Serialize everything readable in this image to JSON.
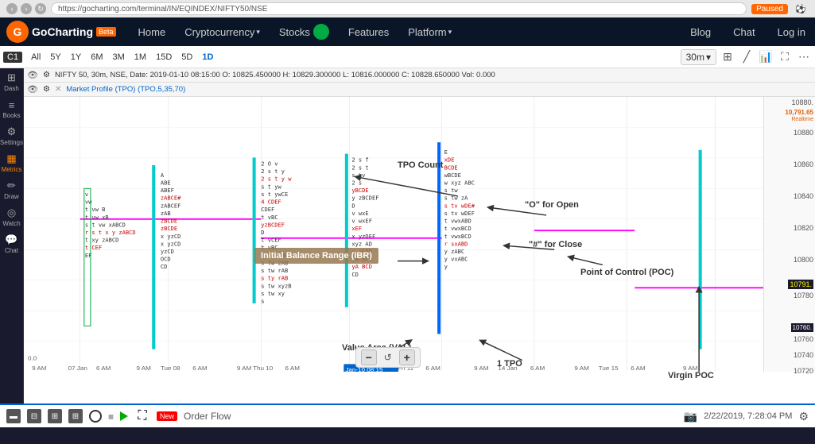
{
  "browser": {
    "url": "https://gocharting.com/terminal/IN/EQINDEX/NIFTY50/NSE",
    "paused_label": "Paused"
  },
  "nav": {
    "logo": "GoCharting",
    "beta_label": "Beta",
    "items": [
      "Home",
      "Cryptocurrency",
      "Stocks",
      "Features",
      "Platform"
    ],
    "right_items": [
      "Blog",
      "Chat",
      "Log in"
    ],
    "crypto_label": "Cryptocurrency",
    "stocks_label": "Stocks",
    "features_label": "Features",
    "platform_label": "Platform",
    "blog_label": "Blog",
    "chat_label": "Chat",
    "login_label": "Log in",
    "home_label": "Home"
  },
  "toolbar": {
    "symbol": "C1",
    "timeframes": [
      "All",
      "5Y",
      "1Y",
      "6M",
      "3M",
      "1M",
      "15D",
      "5D",
      "1D"
    ],
    "interval": "30m",
    "active_tf": "1D"
  },
  "chart_info": {
    "line1": "NIFTY 50, 30m, NSE, Date: 2019-01-10 08:15:00  O: 10825.450000  H: 10829.300000  L: 10816.000000  C: 10828.650000  Vol: 0.000",
    "line2": "Market Profile (TPO) (TPO,5,35,70)"
  },
  "annotations": {
    "tpo_count": "TPO Count",
    "o_for_open": "\"O\" for Open",
    "hash_for_close": "\"#\" for Close",
    "poc_label": "Point of Control (POC)",
    "ibr_label": "Initial Balance Range (IBR)",
    "val_label": "Value Area (VAL)",
    "one_tpo": "1 TPO",
    "virgin_poc": "Virgin POC"
  },
  "price_labels": {
    "top": "10880.",
    "p1": "10880",
    "p2": "10860",
    "p3": "10840",
    "p4": "10820",
    "p5": "10800",
    "p6": "10780",
    "p7": "10760.",
    "current1": "10791.",
    "current2": "10760.",
    "highlight1": "10791.65",
    "highlight2": "10760"
  },
  "time_labels": [
    "9 AM",
    "07 Jan 6 AM",
    "9 AM",
    "Tue 08 6 AM",
    "9 AM",
    "Thu 10 6 AM",
    "Jan-10 08:15",
    "Fri 11 6 AM",
    "9 AM",
    "14 Jan 6 AM",
    "9 AM",
    "Tue 15 6 AM",
    "9 AM"
  ],
  "zoom_controls": {
    "minus": "−",
    "reset": "↺",
    "plus": "+"
  },
  "bottom_bar": {
    "order_flow": "Order Flow",
    "datetime": "2/22/2019, 7:28:04 PM"
  },
  "sidebar_items": [
    {
      "id": "dash",
      "icon": "⊞",
      "label": "Dash"
    },
    {
      "id": "books",
      "icon": "≡",
      "label": "Books"
    },
    {
      "id": "settings",
      "icon": "⚙",
      "label": "Settings"
    },
    {
      "id": "metrics",
      "icon": "📊",
      "label": "Metrics"
    },
    {
      "id": "draw",
      "icon": "✏",
      "label": "Draw"
    },
    {
      "id": "watch",
      "icon": "👁",
      "label": "Watch"
    },
    {
      "id": "chat",
      "icon": "💬",
      "label": "Chat"
    }
  ]
}
